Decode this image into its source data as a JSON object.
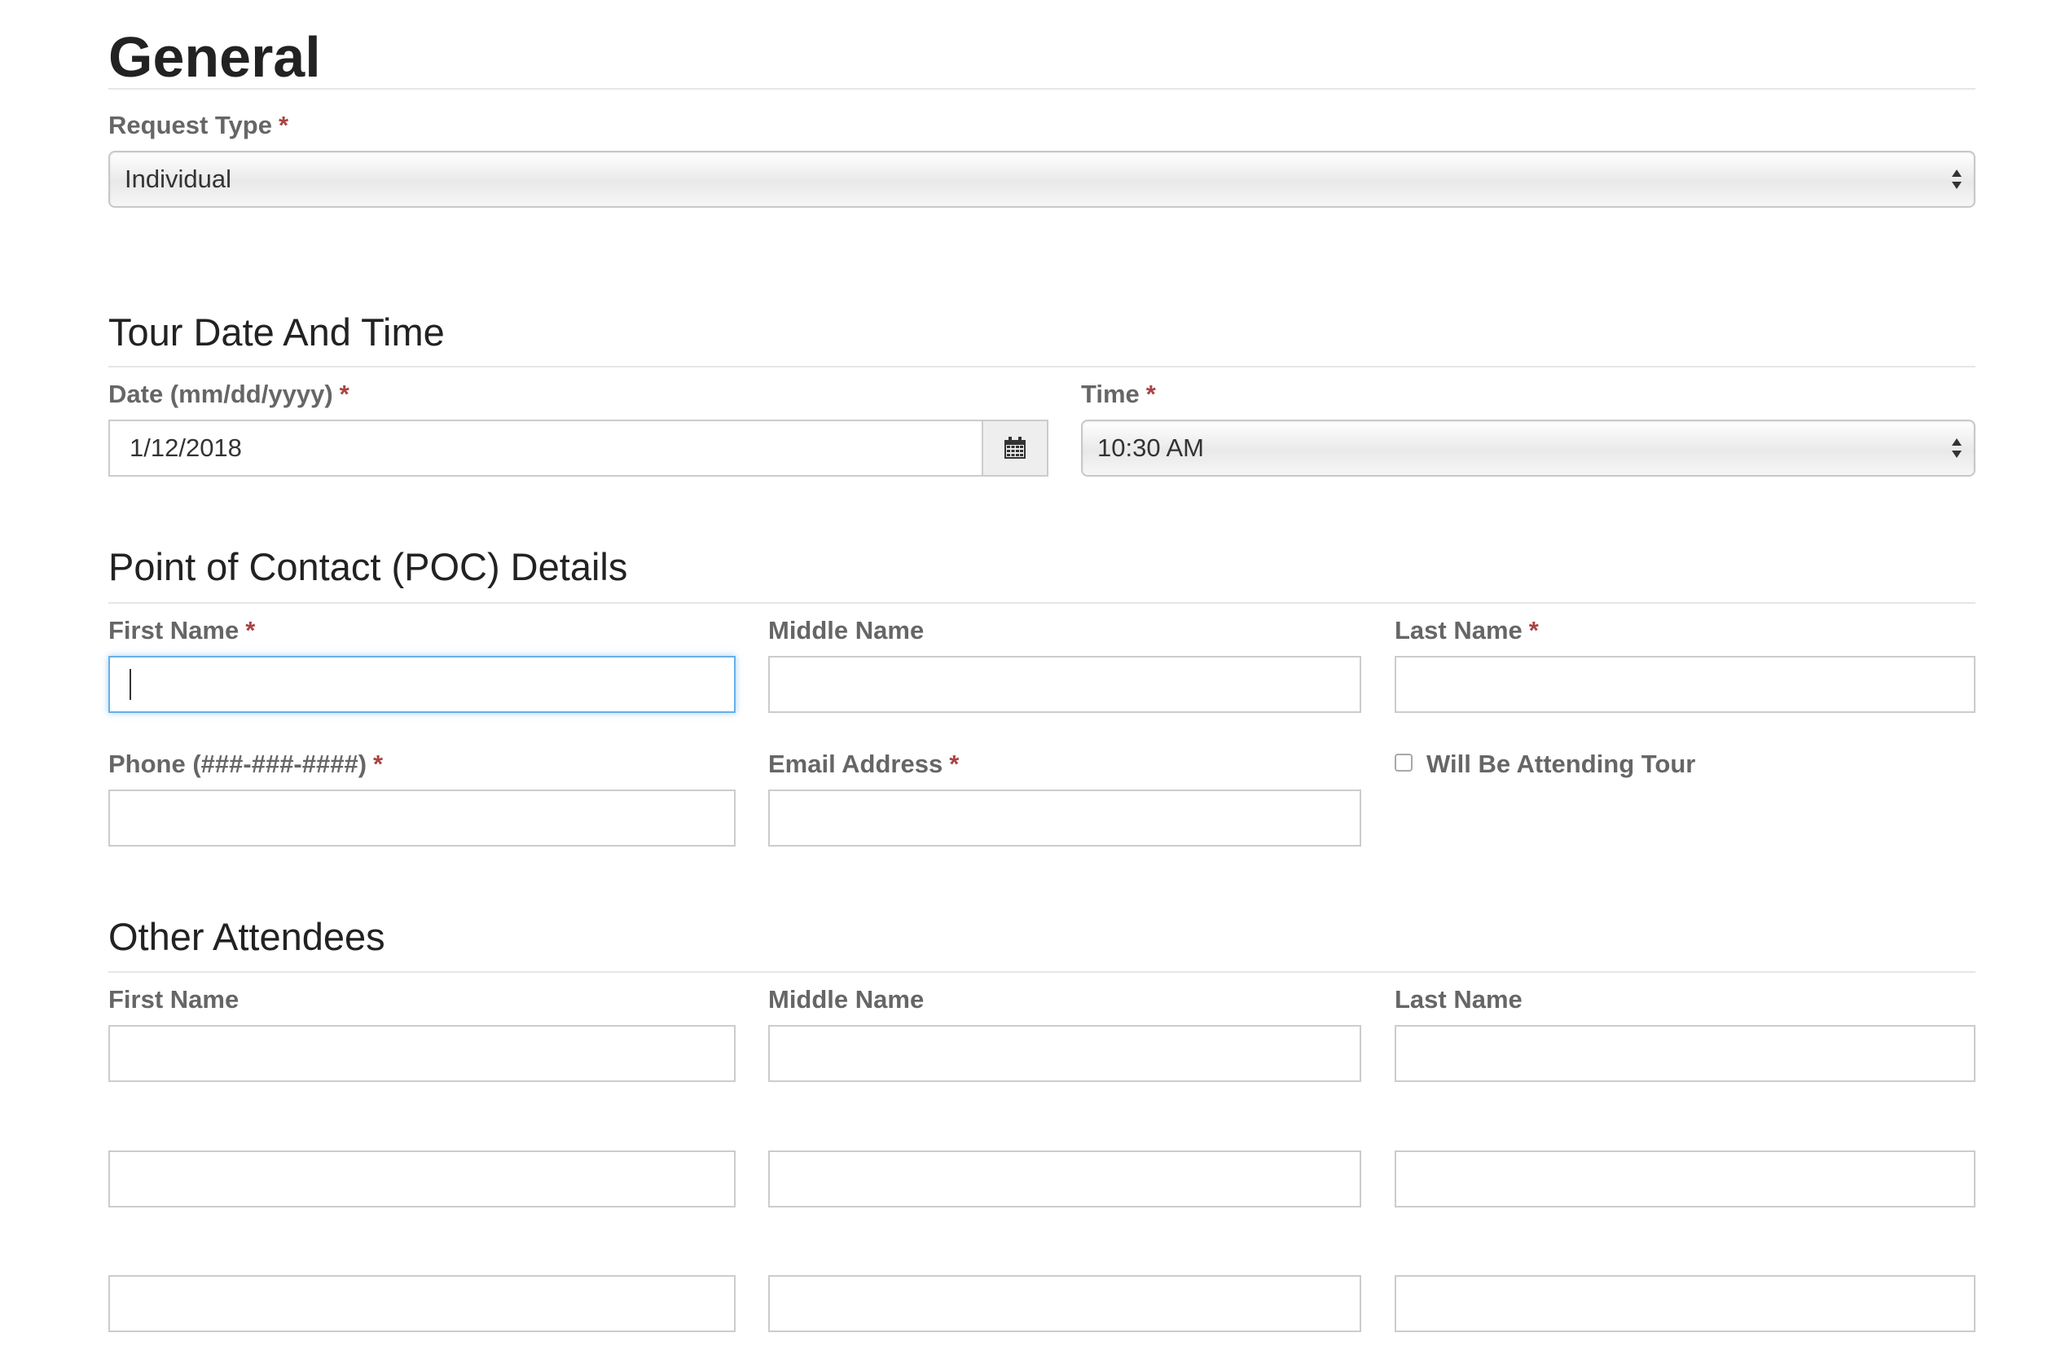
{
  "general": {
    "title": "General",
    "request_type": {
      "label": "Request Type",
      "required_mark": "*",
      "selected": "Individual"
    }
  },
  "tour": {
    "title": "Tour Date And Time",
    "date": {
      "label": "Date (mm/dd/yyyy)",
      "required_mark": "*",
      "value": "1/12/2018"
    },
    "time": {
      "label": "Time",
      "required_mark": "*",
      "selected": "10:30 AM"
    }
  },
  "poc": {
    "title": "Point of Contact (POC) Details",
    "first_name": {
      "label": "First Name",
      "required_mark": "*",
      "value": ""
    },
    "middle_name": {
      "label": "Middle Name",
      "value": ""
    },
    "last_name": {
      "label": "Last Name",
      "required_mark": "*",
      "value": ""
    },
    "phone": {
      "label": "Phone (###-###-####)",
      "required_mark": "*",
      "value": ""
    },
    "email": {
      "label": "Email Address",
      "required_mark": "*",
      "value": ""
    },
    "attending": {
      "label": "Will Be Attending Tour",
      "checked": false
    }
  },
  "attendees": {
    "title": "Other Attendees",
    "headers": {
      "first_name": "First Name",
      "middle_name": "Middle Name",
      "last_name": "Last Name"
    },
    "rows": [
      {
        "first": "",
        "middle": "",
        "last": ""
      },
      {
        "first": "",
        "middle": "",
        "last": ""
      },
      {
        "first": "",
        "middle": "",
        "last": ""
      }
    ]
  },
  "colors": {
    "required": "#a94442",
    "focus_border": "#66afe9",
    "label": "#666666"
  },
  "icons": {
    "calendar": "calendar-icon",
    "select_arrows": "up-down-arrows-icon"
  }
}
